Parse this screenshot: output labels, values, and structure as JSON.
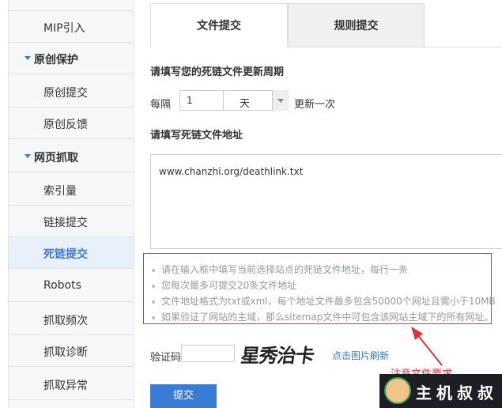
{
  "sidebar": {
    "items": [
      {
        "label": "MIP引入",
        "type": "item"
      },
      {
        "label": "原创保护",
        "type": "group"
      },
      {
        "label": "原创提交",
        "type": "item"
      },
      {
        "label": "原创反馈",
        "type": "item"
      },
      {
        "label": "网页抓取",
        "type": "group"
      },
      {
        "label": "索引量",
        "type": "item"
      },
      {
        "label": "链接提交",
        "type": "item"
      },
      {
        "label": "死链提交",
        "type": "item",
        "active": true
      },
      {
        "label": "Robots",
        "type": "item"
      },
      {
        "label": "抓取频次",
        "type": "item"
      },
      {
        "label": "抓取诊断",
        "type": "item"
      },
      {
        "label": "抓取异常",
        "type": "item"
      }
    ]
  },
  "tabs": [
    "文件提交",
    "规则提交"
  ],
  "period": {
    "title": "请填写您的死链文件更新周期",
    "every_label": "每隔",
    "value": "1",
    "unit": "天",
    "suffix": "更新一次"
  },
  "address": {
    "title": "请填写死链文件地址",
    "value": "www.chanzhi.org/deathlink.txt"
  },
  "tips": [
    "请在输入框中填写当前选择站点的死链文件地址，每行一条",
    "您每次最多可提交20条文件地址",
    "文件地址格式为txt或xml，每个地址文件最多包含50000个网址且需小于10MB",
    "如果验证了网站的主域，那么sitemap文件中可包含该网站主域下的所有网址。"
  ],
  "captcha": {
    "label": "验证码",
    "image_text": "星秀治卡",
    "refresh_link": "点击图片刷新"
  },
  "submit_label": "提交",
  "annotation": "注意文件要求",
  "watermark": "主机叔叔",
  "colors": {
    "accent": "#3a7bd5",
    "annotation": "#e0333a"
  }
}
